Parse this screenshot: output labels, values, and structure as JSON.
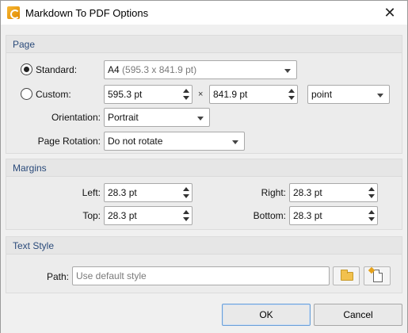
{
  "window": {
    "title": "Markdown To PDF Options"
  },
  "page": {
    "section_title": "Page",
    "standard": {
      "label": "Standard:",
      "selected": true,
      "value_main": "A4",
      "value_detail": "(595.3 x 841.9 pt)"
    },
    "custom": {
      "label": "Custom:",
      "selected": false,
      "width": "595.3 pt",
      "times": "×",
      "height": "841.9 pt",
      "unit": "point"
    },
    "orientation": {
      "label": "Orientation:",
      "value": "Portrait"
    },
    "rotation": {
      "label": "Page Rotation:",
      "value": "Do not rotate"
    }
  },
  "margins": {
    "section_title": "Margins",
    "left": {
      "label": "Left:",
      "value": "28.3 pt"
    },
    "right": {
      "label": "Right:",
      "value": "28.3 pt"
    },
    "top": {
      "label": "Top:",
      "value": "28.3 pt"
    },
    "bottom": {
      "label": "Bottom:",
      "value": "28.3 pt"
    }
  },
  "text_style": {
    "section_title": "Text Style",
    "path_label": "Path:",
    "path_placeholder": "Use default style",
    "browse_icon": "folder-open-icon",
    "new_icon": "new-file-icon"
  },
  "buttons": {
    "ok": "OK",
    "cancel": "Cancel"
  },
  "colors": {
    "section_title": "#2a4a7a",
    "app_icon": "#f2a31a",
    "ok_focus_border": "#6a9fd8"
  }
}
